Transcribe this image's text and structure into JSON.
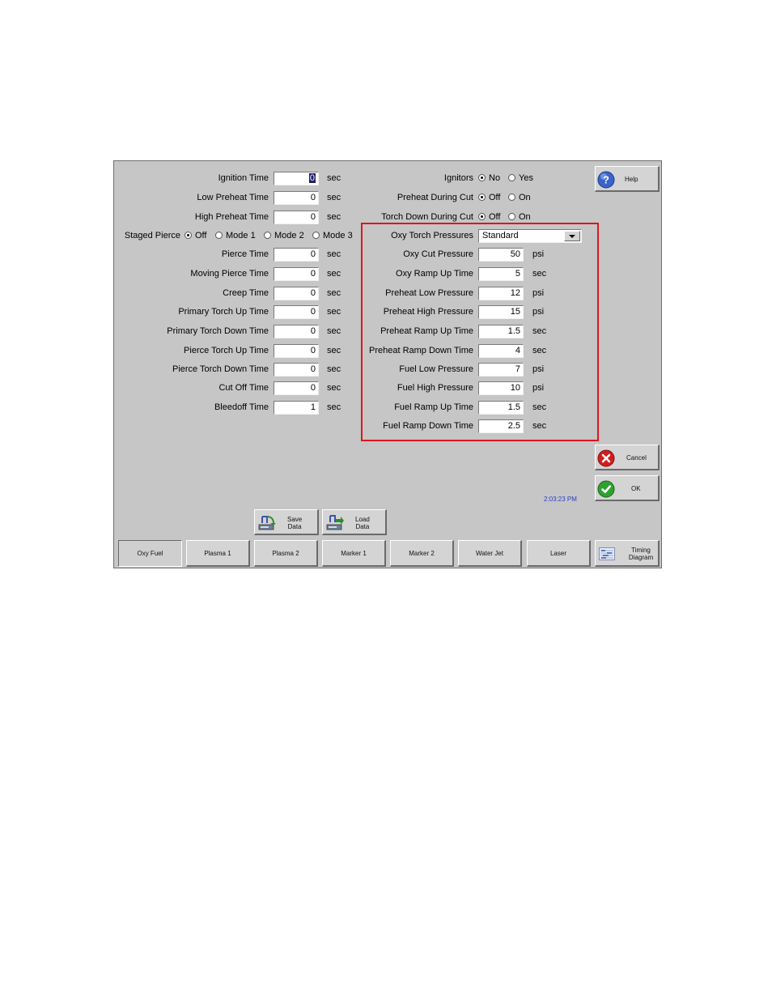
{
  "left_fields": [
    {
      "label": "Ignition Time",
      "value": "0",
      "unit": "sec",
      "selected": true
    },
    {
      "label": "Low Preheat Time",
      "value": "0",
      "unit": "sec"
    },
    {
      "label": "High Preheat Time",
      "value": "0",
      "unit": "sec"
    },
    {
      "label": "Pierce Time",
      "value": "0",
      "unit": "sec"
    },
    {
      "label": "Moving Pierce Time",
      "value": "0",
      "unit": "sec"
    },
    {
      "label": "Creep Time",
      "value": "0",
      "unit": "sec"
    },
    {
      "label": "Primary Torch Up Time",
      "value": "0",
      "unit": "sec"
    },
    {
      "label": "Primary Torch Down Time",
      "value": "0",
      "unit": "sec"
    },
    {
      "label": "Pierce Torch Up Time",
      "value": "0",
      "unit": "sec"
    },
    {
      "label": "Pierce Torch Down Time",
      "value": "0",
      "unit": "sec"
    },
    {
      "label": "Cut Off Time",
      "value": "0",
      "unit": "sec"
    },
    {
      "label": "Bleedoff Time",
      "value": "1",
      "unit": "sec"
    }
  ],
  "staged_pierce": {
    "label": "Staged Pierce",
    "options": [
      "Off",
      "Mode 1",
      "Mode 2",
      "Mode 3"
    ],
    "selected": "Off"
  },
  "ignitors": {
    "label": "Ignitors",
    "options": [
      "No",
      "Yes"
    ],
    "selected": "No"
  },
  "preheat_during_cut": {
    "label": "Preheat During Cut",
    "options": [
      "Off",
      "On"
    ],
    "selected": "Off"
  },
  "torch_down_during_cut": {
    "label": "Torch Down During Cut",
    "options": [
      "Off",
      "On"
    ],
    "selected": "Off"
  },
  "oxy_torch_pressures": {
    "label": "Oxy Torch Pressures",
    "value": "Standard"
  },
  "right_fields": [
    {
      "label": "Oxy Cut Pressure",
      "value": "50",
      "unit": "psi"
    },
    {
      "label": "Oxy Ramp Up Time",
      "value": "5",
      "unit": "sec"
    },
    {
      "label": "Preheat Low Pressure",
      "value": "12",
      "unit": "psi"
    },
    {
      "label": "Preheat High Pressure",
      "value": "15",
      "unit": "psi"
    },
    {
      "label": "Preheat Ramp Up Time",
      "value": "1.5",
      "unit": "sec"
    },
    {
      "label": "Preheat Ramp Down Time",
      "value": "4",
      "unit": "sec"
    },
    {
      "label": "Fuel Low Pressure",
      "value": "7",
      "unit": "psi"
    },
    {
      "label": "Fuel High Pressure",
      "value": "10",
      "unit": "psi"
    },
    {
      "label": "Fuel Ramp Up Time",
      "value": "1.5",
      "unit": "sec"
    },
    {
      "label": "Fuel Ramp Down Time",
      "value": "2.5",
      "unit": "sec"
    }
  ],
  "buttons": {
    "help": "Help",
    "cancel": "Cancel",
    "ok": "OK",
    "save_line1": "Save",
    "save_line2": "Data",
    "load_line1": "Load",
    "load_line2": "Data",
    "timing_line1": "Timing",
    "timing_line2": "Diagram"
  },
  "clock": "2:03:23 PM",
  "tabs": [
    "Oxy Fuel",
    "Plasma 1",
    "Plasma 2",
    "Marker 1",
    "Marker 2",
    "Water Jet",
    "Laser"
  ],
  "active_tab": "Oxy Fuel",
  "colors": {
    "highlight_box": "#e0151b",
    "clock_text": "#2a3fc4",
    "panel_bg": "#c6c6c6"
  },
  "icons": {
    "help": "question-icon",
    "cancel": "x-icon",
    "ok": "check-icon",
    "save": "save-disk-icon",
    "load": "load-disk-icon",
    "timing": "timing-diagram-icon"
  }
}
